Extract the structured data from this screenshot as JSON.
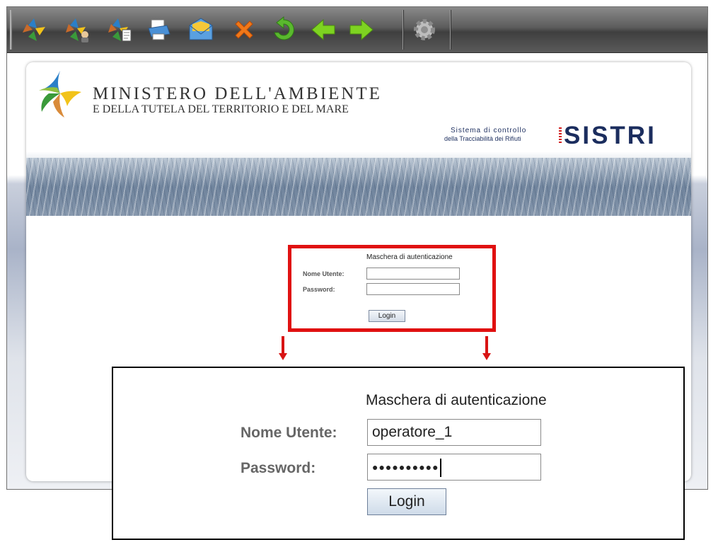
{
  "toolbar": {
    "buttons": [
      {
        "name": "sistri-star-icon"
      },
      {
        "name": "sistri-user-icon"
      },
      {
        "name": "sistri-edit-icon"
      },
      {
        "name": "printer-icon"
      },
      {
        "name": "email-icon"
      },
      {
        "name": "close-icon"
      },
      {
        "name": "refresh-icon"
      },
      {
        "name": "back-arrow-icon"
      },
      {
        "name": "forward-arrow-icon"
      },
      {
        "name": "settings-gear-icon"
      }
    ]
  },
  "header": {
    "ministry_name": "MINISTERO DELL'AMBIENTE",
    "ministry_sub": "E DELLA TUTELA DEL TERRITORIO E DEL MARE",
    "sistri_tagline_1": "Sistema di controllo",
    "sistri_tagline_2": "della Tracciabilità dei Rifiuti",
    "sistri_logo": "SISTRI"
  },
  "login": {
    "title": "Maschera di autenticazione",
    "username_label": "Nome Utente:",
    "password_label": "Password:",
    "login_button": "Login"
  },
  "login_zoom": {
    "title": "Maschera di autenticazione",
    "username_label": "Nome Utente:",
    "password_label": "Password:",
    "username_value": "operatore_1",
    "password_value": "●●●●●●●●●●",
    "login_button": "Login"
  },
  "colors": {
    "highlight": "#e01010",
    "sistri_blue": "#1b2d5e"
  }
}
